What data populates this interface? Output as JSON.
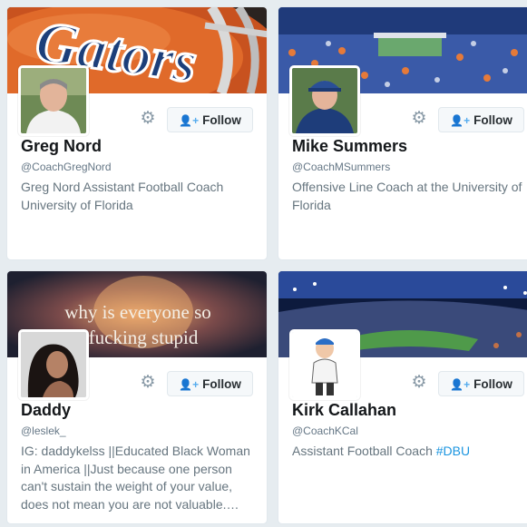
{
  "cards": [
    {
      "name": "Greg Nord",
      "handle": "@CoachGregNord",
      "bio": "Greg Nord Assistant Football Coach University of Florida",
      "banner_text": "Gators",
      "follow_label": "Follow"
    },
    {
      "name": "Mike Summers",
      "handle": "@CoachMSummers",
      "bio": "Offensive Line Coach at the University of Florida",
      "follow_label": "Follow"
    },
    {
      "name": "Daddy",
      "handle": "@leslek_",
      "bio": "IG: daddykelss ||Educated Black Woman in America ||Just because one person can't sustain the weight of your value, does not mean you are not valuable.…",
      "banner_text_line1": "why is everyone so",
      "banner_text_line2": "fucking stupid",
      "follow_label": "Follow"
    },
    {
      "name": "Kirk Callahan",
      "handle": "@CoachKCal",
      "bio_text": "Assistant Football Coach ",
      "bio_hashtag": "#DBU",
      "follow_label": "Follow"
    }
  ],
  "icons": {
    "settings": "gear-icon",
    "follow": "person-add-icon"
  },
  "colors": {
    "link": "#1b95e0",
    "accent": "#55acee"
  }
}
